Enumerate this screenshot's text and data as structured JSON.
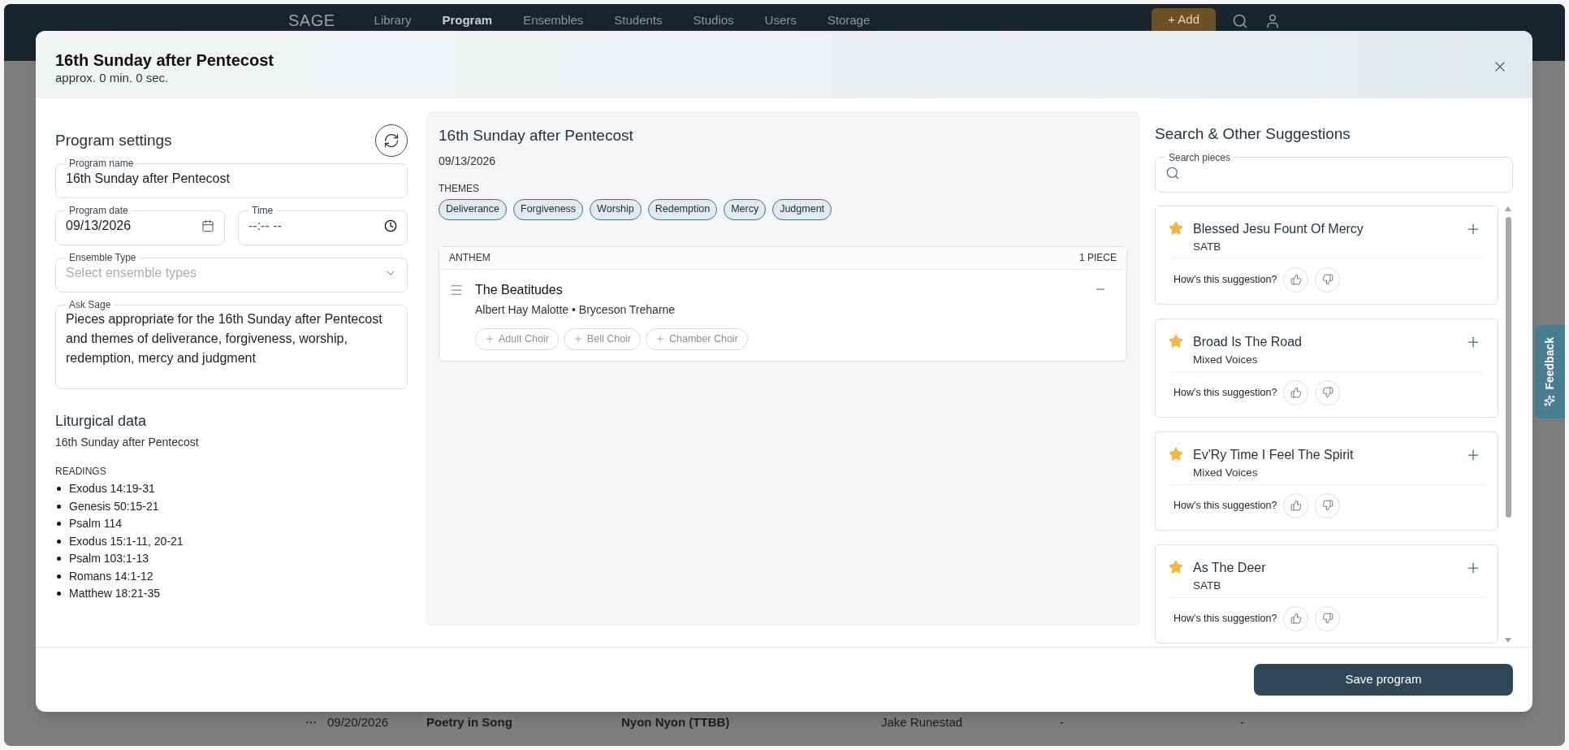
{
  "app_header": {
    "logo": "SAGE",
    "nav": [
      {
        "label": "Library",
        "selected": false
      },
      {
        "label": "Program",
        "selected": true
      },
      {
        "label": "Ensembles",
        "selected": false
      },
      {
        "label": "Students",
        "selected": false
      },
      {
        "label": "Studios",
        "selected": false
      },
      {
        "label": "Users",
        "selected": false
      },
      {
        "label": "Storage",
        "selected": false
      }
    ],
    "add_button": "+ Add"
  },
  "background_row": {
    "date": "09/20/2026",
    "title": "Poetry in Song",
    "piece": "Nyon Nyon (TTBB)",
    "composer": "Jake Runestad",
    "column_5": "-",
    "column_6": "-"
  },
  "dialog": {
    "title": "16th Sunday after Pentecost",
    "subtitle": "approx. 0 min. 0 sec.",
    "program_settings": {
      "heading": "Program settings",
      "name": {
        "label": "Program name",
        "value": "16th Sunday after Pentecost"
      },
      "date": {
        "label": "Program date",
        "value": "09/13/2026"
      },
      "time": {
        "label": "Time",
        "value": "--:-- --"
      },
      "ensemble_type": {
        "label": "Ensemble Type",
        "placeholder": "Select ensemble types"
      },
      "ask_sage": {
        "label": "Ask Sage",
        "value": "Pieces appropriate for the 16th Sunday after Pentecost and themes of deliverance, forgiveness, worship, redemption, mercy and judgment"
      }
    },
    "liturgical": {
      "heading": "Liturgical data",
      "subtitle": "16th Sunday after Pentecost",
      "readings_label": "READINGS",
      "readings": [
        "Exodus 14:19-31",
        "Genesis 50:15-21",
        "Psalm 114",
        "Exodus 15:1-11, 20-21",
        "Psalm 103:1-13",
        "Romans 14:1-12",
        "Matthew 18:21-35"
      ]
    },
    "program": {
      "title": "16th Sunday after Pentecost",
      "date": "09/13/2026",
      "themes_label": "THEMES",
      "themes": [
        "Deliverance",
        "Forgiveness",
        "Worship",
        "Redemption",
        "Mercy",
        "Judgment"
      ],
      "sections": [
        {
          "label": "ANTHEM",
          "count": "1 PIECE",
          "pieces": [
            {
              "title": "The Beatitudes",
              "composers": "Albert Hay Malotte • Bryceson Treharne",
              "ensembles": [
                "Adult Choir",
                "Bell Choir",
                "Chamber Choir"
              ]
            }
          ]
        }
      ]
    },
    "suggestions": {
      "heading": "Search & Other Suggestions",
      "search_label": "Search pieces",
      "items": [
        {
          "title": "Blessed Jesu Fount Of Mercy",
          "voicing": "SATB",
          "starred": true,
          "prompt": "How's this suggestion?"
        },
        {
          "title": "Broad Is The Road",
          "voicing": "Mixed Voices",
          "starred": true,
          "prompt": "How's this suggestion?"
        },
        {
          "title": "Ev'Ry Time I Feel The Spirit",
          "voicing": "Mixed Voices",
          "starred": true,
          "prompt": "How's this suggestion?"
        },
        {
          "title": "As The Deer",
          "voicing": "SATB",
          "starred": true,
          "prompt": "How's this suggestion?"
        }
      ]
    },
    "save_button": "Save program"
  },
  "feedback_tab": "Feedback"
}
